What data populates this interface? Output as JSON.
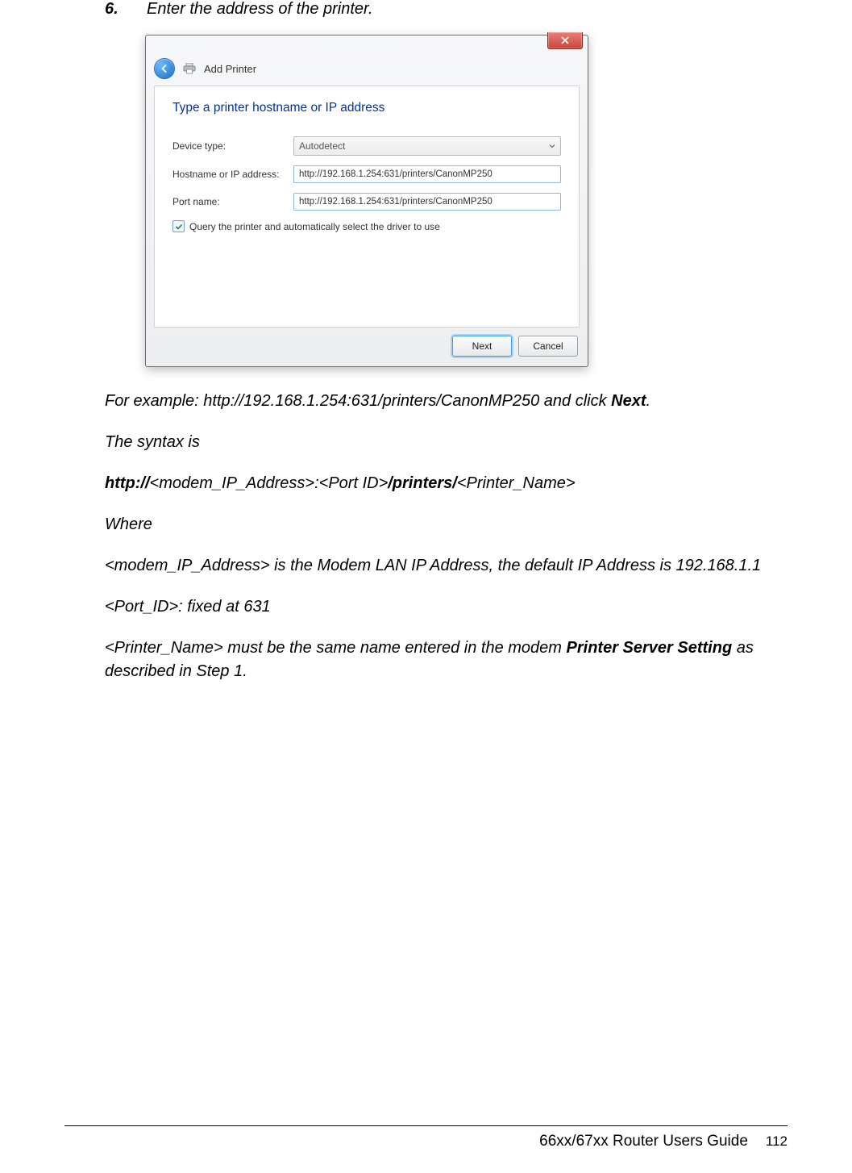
{
  "step": {
    "number": "6.",
    "text": "Enter the address of the printer."
  },
  "dialog": {
    "breadcrumb": "Add Printer",
    "heading": "Type a printer hostname or IP address",
    "deviceTypeLabel": "Device type:",
    "deviceTypeValue": "Autodetect",
    "hostnameLabel": "Hostname or IP address:",
    "hostnameValue": "http://192.168.1.254:631/printers/CanonMP250",
    "portLabel": "Port name:",
    "portValue": "http://192.168.1.254:631/printers/CanonMP250",
    "checkboxLabel": "Query the printer and automatically select the driver to use",
    "nextLabel": "Next",
    "cancelLabel": "Cancel"
  },
  "body": {
    "example_pre": "For example: http://192.168.1.254:631/printers/CanonMP250 and click ",
    "example_bold": "Next",
    "example_post": ".",
    "syntax_intro": "The syntax is",
    "syntax_b1": "http://",
    "syntax_t1": "<modem_IP_Address>:<Port ID>",
    "syntax_b2": "/printers/",
    "syntax_t2": "<Printer_Name>",
    "where": "Where",
    "line1": "<modem_IP_Address> is the Modem LAN IP Address, the default IP Address is 192.168.1.1",
    "line2": "<Port_ID>: fixed at 631",
    "line3_pre": "<Printer_Name> must be the same name entered in the modem ",
    "line3_bold": "Printer Server Setting",
    "line3_post": " as described in Step 1."
  },
  "footer": {
    "title": "66xx/67xx Router Users Guide",
    "page": "112"
  }
}
